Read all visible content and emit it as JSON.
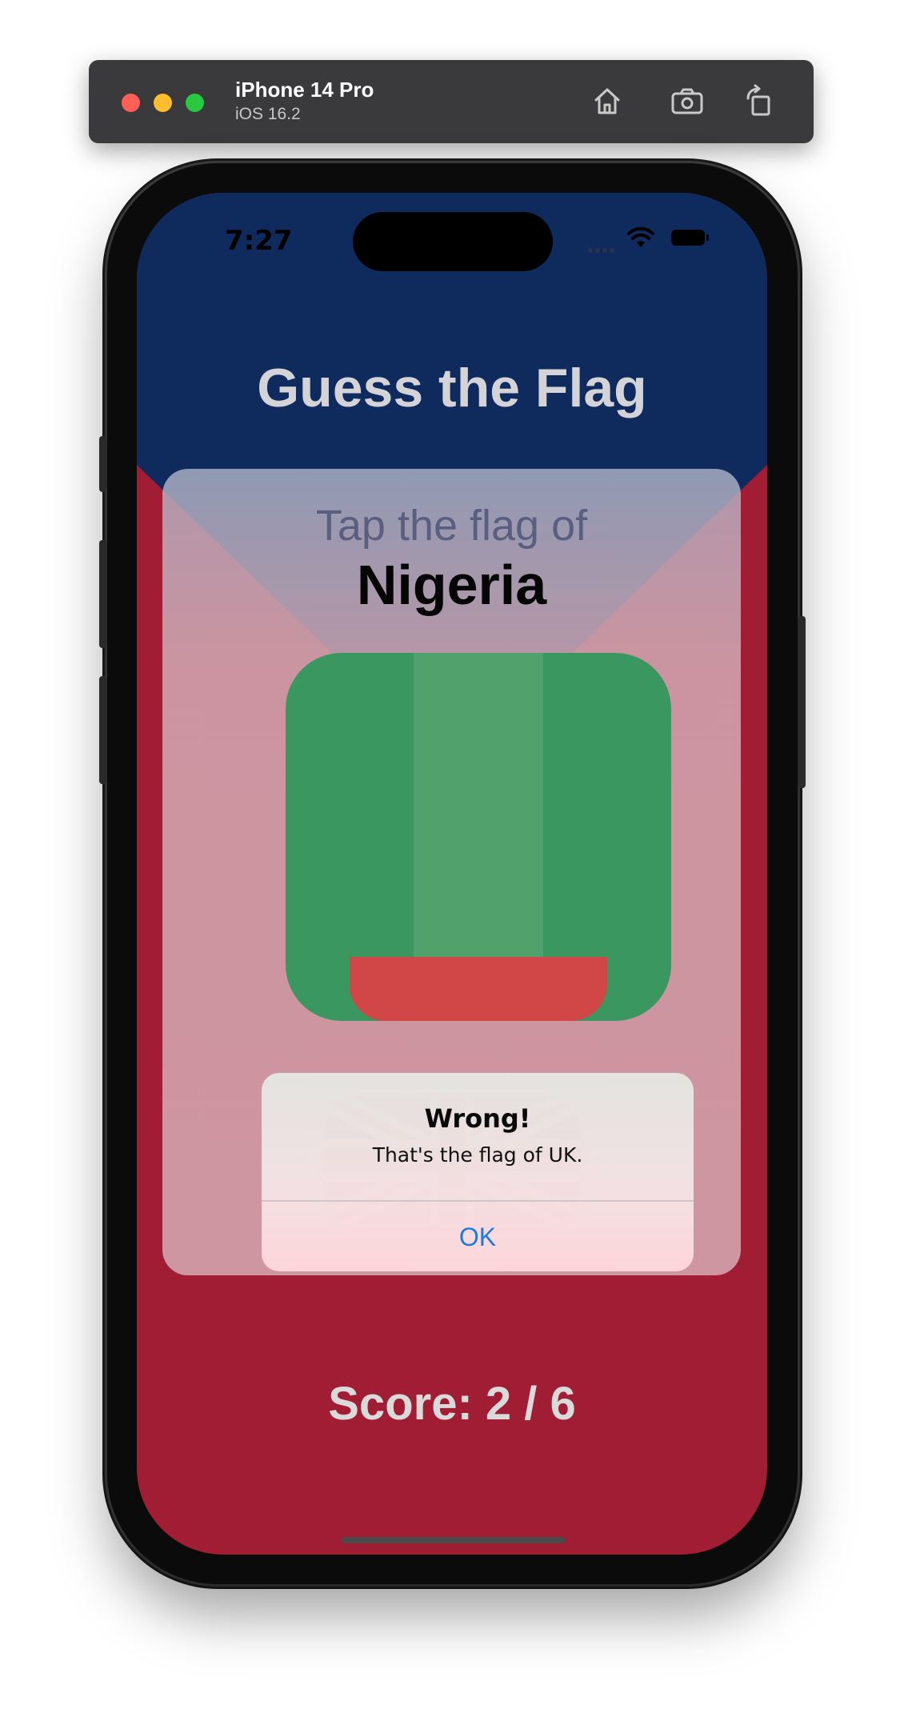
{
  "simulator": {
    "device_name": "iPhone 14 Pro",
    "os_version": "iOS 16.2",
    "buttons": [
      "home-icon",
      "screenshot-icon",
      "rotate-icon"
    ]
  },
  "status_bar": {
    "time": "7:27"
  },
  "app": {
    "title": "Guess the Flag",
    "prompt": "Tap the flag of",
    "country": "Nigeria",
    "flags": [
      "Nigeria",
      "UK"
    ],
    "score_text": "Score: 2 / 6"
  },
  "alert": {
    "title": "Wrong!",
    "message": "That's the flag of UK.",
    "ok_label": "OK"
  },
  "colors": {
    "top_background": "#0f2a5c",
    "bottom_background": "#a11d33",
    "alert_button": "#1f7ae0"
  }
}
